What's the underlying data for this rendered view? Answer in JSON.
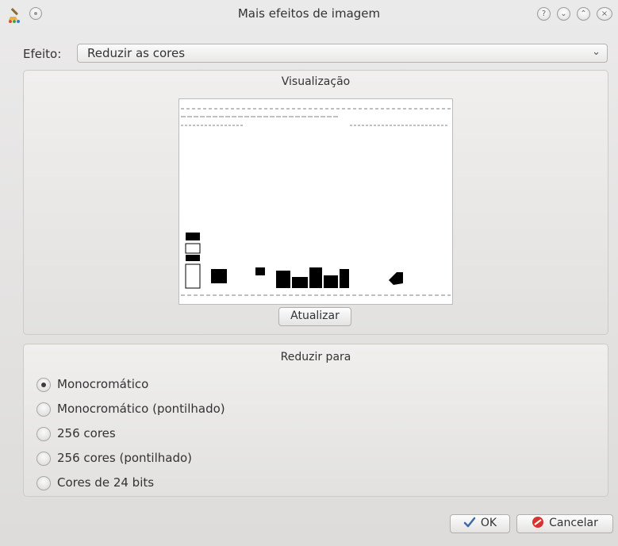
{
  "window": {
    "title": "Mais efeitos de imagem",
    "buttons": {
      "help": "?",
      "minimize": "⌄",
      "maximize": "⌃",
      "close": "×"
    }
  },
  "effect": {
    "label": "Efeito:",
    "value": "Reduzir as cores",
    "arrow": "⌄"
  },
  "preview_group": {
    "title": "Visualização",
    "update_button": "Atualizar"
  },
  "reduce_group": {
    "title": "Reduzir para",
    "options": [
      {
        "label": "Monocromático",
        "checked": true
      },
      {
        "label": "Monocromático (pontilhado)",
        "checked": false
      },
      {
        "label": "256 cores",
        "checked": false
      },
      {
        "label": "256 cores (pontilhado)",
        "checked": false
      },
      {
        "label": "Cores de 24 bits",
        "checked": false
      }
    ]
  },
  "footer": {
    "ok": "OK",
    "cancel": "Cancelar"
  },
  "colors": {
    "accent_ok": "#3f6aa7",
    "cancel_red": "#d9322f"
  }
}
